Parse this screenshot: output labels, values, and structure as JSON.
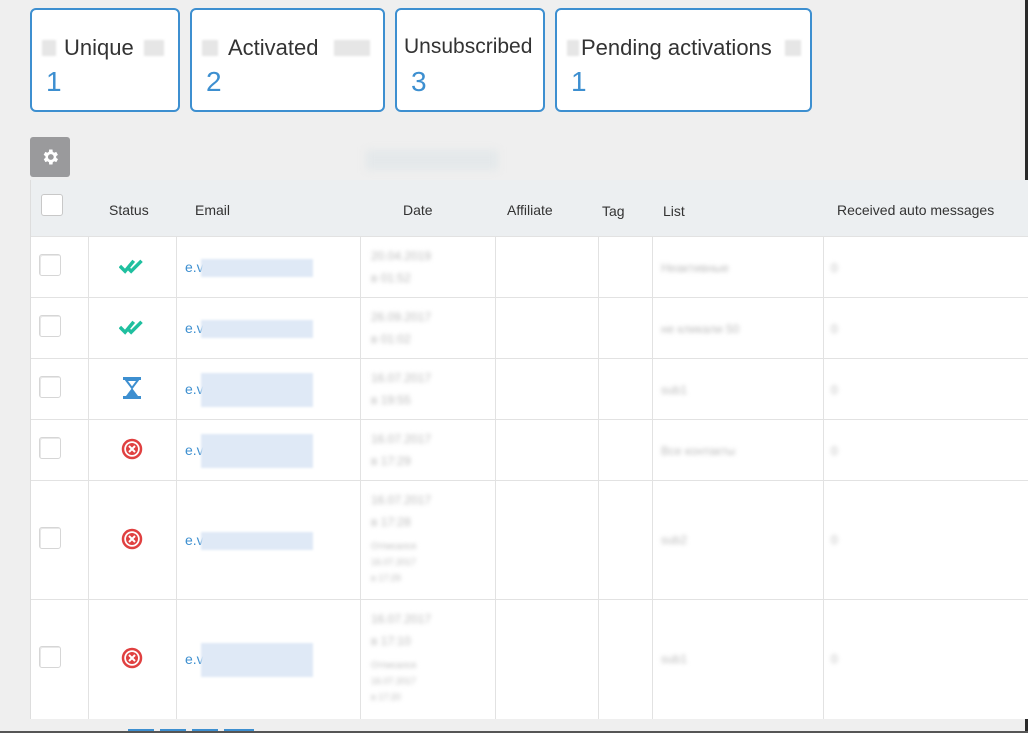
{
  "stats": [
    {
      "label": "Unique",
      "value": "1"
    },
    {
      "label": "Activated",
      "value": "2"
    },
    {
      "label": "Unsubscribed",
      "value": "3"
    },
    {
      "label": "Pending activations",
      "value": "1"
    }
  ],
  "table": {
    "headers": {
      "status": "Status",
      "email": "Email",
      "date": "Date",
      "affiliate": "Affiliate",
      "tag": "Tag",
      "list": "List",
      "received": "Received auto messages"
    },
    "rows": [
      {
        "status": "activated",
        "status_icon": "double-check-icon",
        "email_prefix": "e.v"
      },
      {
        "status": "activated",
        "status_icon": "double-check-icon",
        "email_prefix": "e.v"
      },
      {
        "status": "pending",
        "status_icon": "hourglass-icon",
        "email_prefix": "e.v"
      },
      {
        "status": "unsubscribed",
        "status_icon": "x-circle-icon",
        "email_prefix": "e.v"
      },
      {
        "status": "unsubscribed",
        "status_icon": "x-circle-icon",
        "email_prefix": "e.v"
      },
      {
        "status": "unsubscribed",
        "status_icon": "x-circle-icon",
        "email_prefix": "e.v"
      }
    ]
  },
  "colors": {
    "accent": "#3d8fd0",
    "activated": "#1fbf9f",
    "pending": "#3d8fd0",
    "unsubscribed": "#e04040"
  }
}
